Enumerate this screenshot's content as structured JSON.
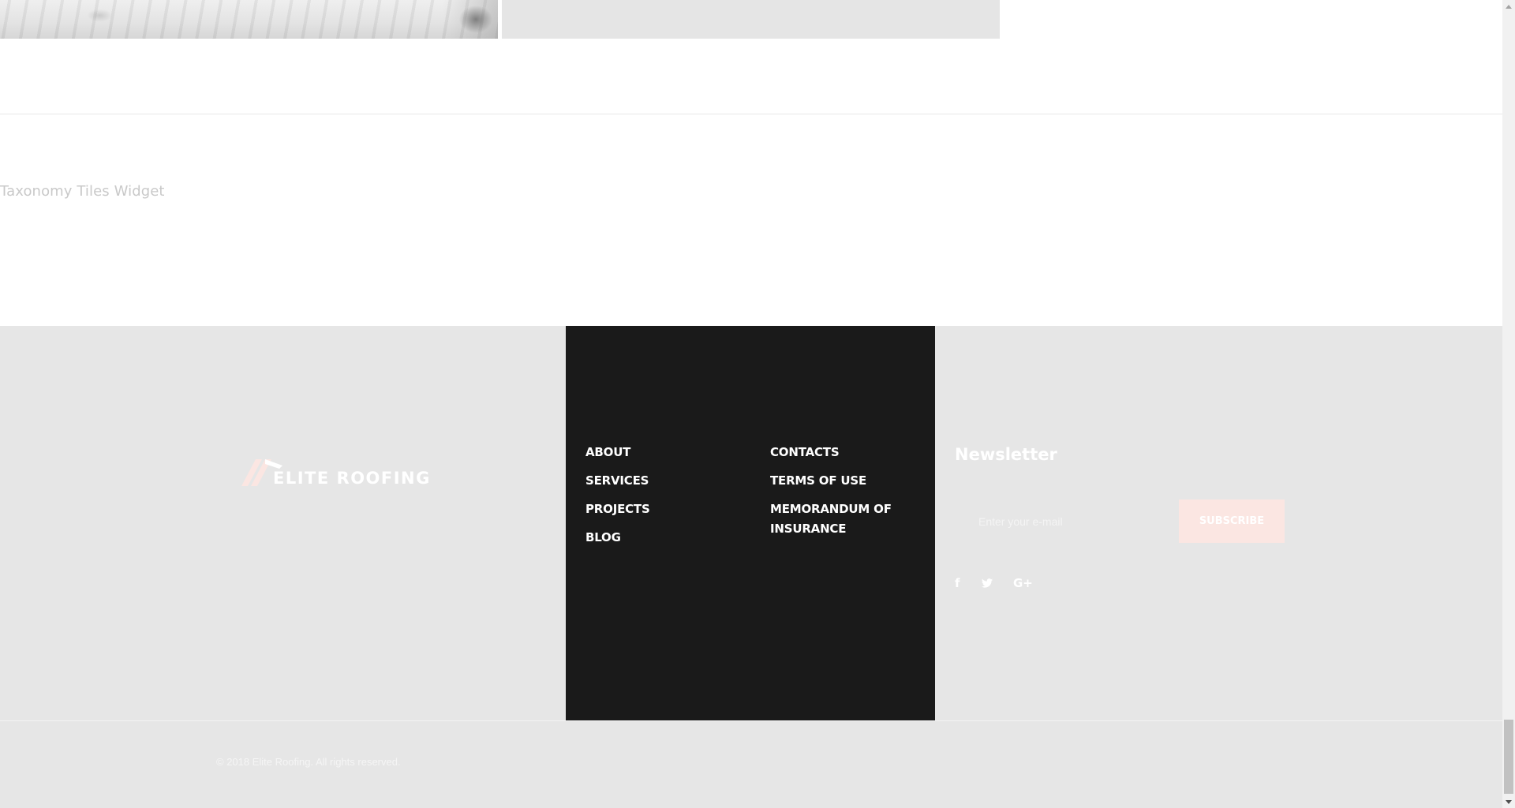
{
  "top_images": [
    {
      "kind": "roof-tiles-photo"
    },
    {
      "kind": "placeholder-gray"
    }
  ],
  "widget": {
    "title": "Taxonomy Tiles Widget"
  },
  "footer": {
    "logo": {
      "text": "ELITE ROOFING",
      "mark_color": "#fbe6e2",
      "text_color": "#ffffff"
    },
    "menu": {
      "column1": [
        "ABOUT",
        "SERVICES",
        "PROJECTS",
        "BLOG"
      ],
      "column2": [
        "CONTACTS",
        "TERMS OF USE",
        "MEMORANDUM OF INSURANCE"
      ]
    },
    "newsletter": {
      "title": "Newsletter",
      "email_placeholder": "Enter your e-mail",
      "subscribe_label": "SUBSCRIBE"
    },
    "socials": [
      {
        "name": "facebook-icon",
        "glyph": "f"
      },
      {
        "name": "twitter-icon",
        "glyph": "🐦"
      },
      {
        "name": "google-plus-icon",
        "glyph": "G+"
      }
    ],
    "copyright": "© 2018 Elite Roofing. All rights reserved."
  },
  "colors": {
    "footer_bg": "#e6e6e6",
    "menu_bg": "#1a1a1a",
    "accent": "#fbe6e2"
  }
}
